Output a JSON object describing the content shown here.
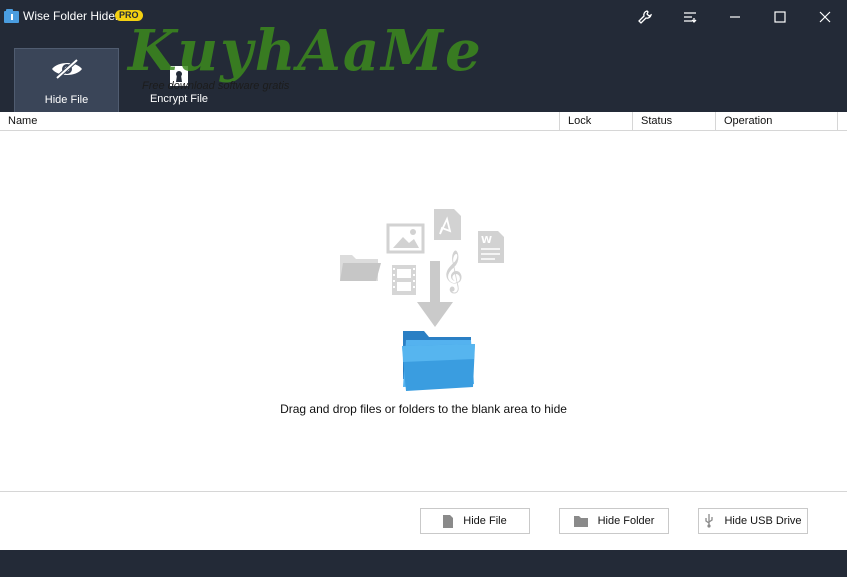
{
  "app": {
    "title": "Wise Folder Hider",
    "badge": "PRO"
  },
  "window_controls": [
    "settings-icon",
    "menu-icon",
    "minimize-icon",
    "maximize-icon",
    "close-icon"
  ],
  "tabs": [
    {
      "label": "Hide File",
      "icon": "eye-slash-icon",
      "active": true
    },
    {
      "label": "Encrypt File",
      "icon": "keyhole-icon",
      "active": false
    }
  ],
  "watermark": {
    "text": "KuyhAaMe",
    "subtext": "Free download software gratis"
  },
  "table": {
    "columns": [
      "Name",
      "Lock",
      "Status",
      "Operation"
    ]
  },
  "drop_zone": {
    "message": "Drag and drop files or folders to the blank area to hide",
    "icons": [
      "folder-icon",
      "image-icon",
      "pdf-icon",
      "word-doc-icon",
      "film-icon",
      "music-icon",
      "arrow-down-icon",
      "blue-folder-icon"
    ]
  },
  "footer": {
    "buttons": [
      {
        "label": "Hide File",
        "icon": "file-icon"
      },
      {
        "label": "Hide Folder",
        "icon": "folder-icon"
      },
      {
        "label": "Hide USB Drive",
        "icon": "usb-icon"
      }
    ]
  },
  "colors": {
    "titlebar": "#232a37",
    "active_tab": "#3a4558",
    "badge": "#f3d012",
    "folder_blue": "#3a9de0",
    "watermark_green": "#3c8a1e"
  }
}
